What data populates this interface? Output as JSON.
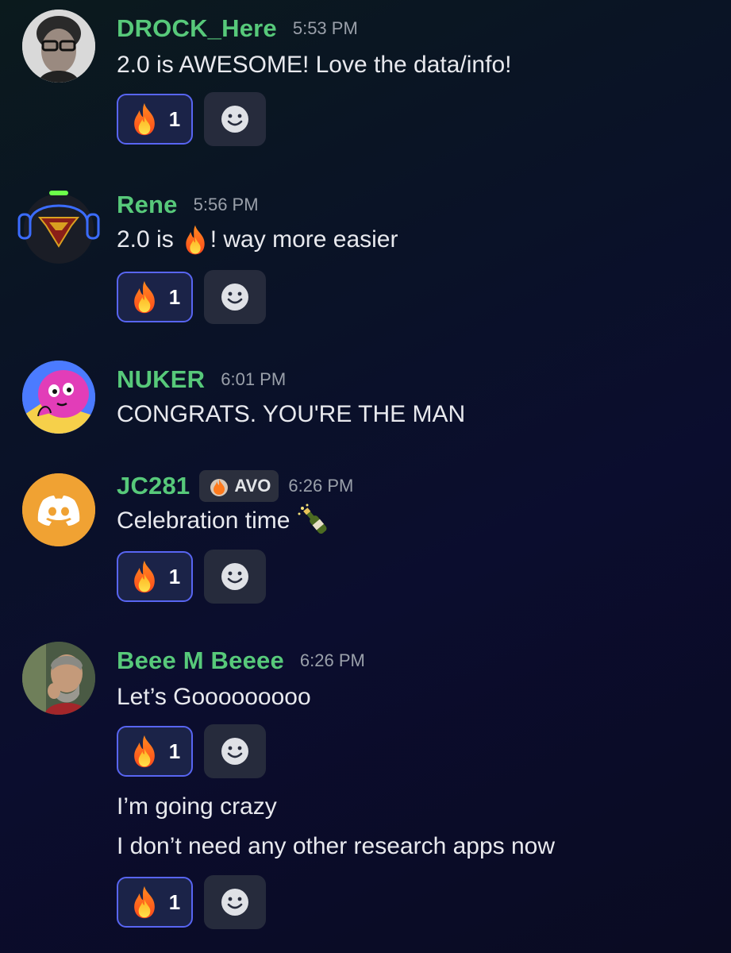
{
  "messages": [
    {
      "username": "DROCK_Here",
      "time": "5:53 PM",
      "text": "2.0 is AWESOME!  Love the data/info!",
      "reaction": {
        "emoji": "fire-icon",
        "count": "1"
      }
    },
    {
      "username": "Rene",
      "time": "5:56 PM",
      "text_before": "2.0 is",
      "text_after": "!  way more easier",
      "inline_emoji": "fire-icon",
      "reaction": {
        "emoji": "fire-icon",
        "count": "1"
      }
    },
    {
      "username": "NUKER",
      "time": "6:01 PM",
      "text": "CONGRATS. YOU'RE THE MAN"
    },
    {
      "username": "JC281",
      "tag": "AVO",
      "time": "6:26 PM",
      "text": "Celebration time",
      "inline_emoji": "champagne-icon",
      "reaction": {
        "emoji": "fire-icon",
        "count": "1"
      }
    },
    {
      "username": "Beee M Beeee",
      "time": "6:26 PM",
      "text": "Let’s Gooooooooo",
      "reaction": {
        "emoji": "fire-icon",
        "count": "1"
      },
      "followups": [
        "I’m going crazy",
        "I don’t need any other research apps now"
      ],
      "followup_reaction": {
        "emoji": "fire-icon",
        "count": "1"
      }
    }
  ],
  "colors": {
    "username": "#57c97a",
    "timestamp": "#9aa0aa",
    "reaction_border": "#5865f2",
    "reaction_bg": "#1b2348",
    "discord_avatar": "#f0a233"
  }
}
